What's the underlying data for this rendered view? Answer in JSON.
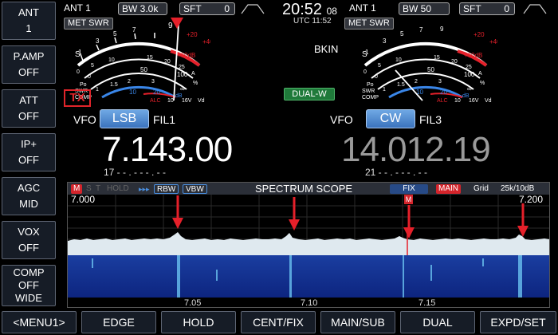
{
  "left_buttons": [
    {
      "l1": "ANT",
      "l2": "1",
      "l3": ""
    },
    {
      "l1": "P.AMP",
      "l2": "OFF",
      "l3": ""
    },
    {
      "l1": "ATT",
      "l2": "OFF",
      "l3": ""
    },
    {
      "l1": "IP+",
      "l2": "OFF",
      "l3": ""
    },
    {
      "l1": "AGC",
      "l2": "MID",
      "l3": ""
    },
    {
      "l1": "VOX",
      "l2": "OFF",
      "l3": ""
    },
    {
      "l1": "COMP",
      "l2": "OFF",
      "l3": "WIDE"
    }
  ],
  "bottom_buttons": [
    "<MENU1>",
    "EDGE",
    "HOLD",
    "CENT/FIX",
    "MAIN/SUB",
    "DUAL",
    "EXPD/SET"
  ],
  "main": {
    "ant": "ANT 1",
    "bw": "BW 3.0k",
    "sft_label": "SFT",
    "sft_value": "0",
    "met": "MET",
    "swr": "SWR",
    "tx": "TX",
    "vfo_label": "VFO",
    "mode": "LSB",
    "filter": "FIL1",
    "freq": "7.143.00",
    "sub_line": "17  - - . - - - . - -"
  },
  "sub": {
    "ant": "ANT 1",
    "bw": "BW 50",
    "sft_label": "SFT",
    "sft_value": "0",
    "met": "MET",
    "swr": "SWR",
    "bkin": "BKIN",
    "vfo_label": "VFO",
    "mode": "CW",
    "filter": "FIL3",
    "freq": "14.012.19",
    "sub_line": "21  - - . - - - . - -"
  },
  "clock": {
    "time": "20:52",
    "seconds": "08",
    "utc": "UTC 11:52"
  },
  "dual_w": "DUAL-W",
  "meter_labels": {
    "s_scale": [
      "1",
      "3",
      "5",
      "7",
      "9"
    ],
    "db_scale": [
      "+20",
      "+40",
      "+60dB"
    ],
    "po_scale": [
      "0",
      "50",
      "100",
      "%"
    ],
    "swr_scale": [
      "1",
      "1.5",
      "2",
      "3",
      "∞"
    ],
    "comp_scale": [
      "10",
      "20",
      "dB"
    ],
    "alc_label": "ALC",
    "vd_scale": [
      "10",
      "16V",
      "Vd"
    ],
    "left_tags": [
      "S",
      "Po",
      "SWR",
      "COMP"
    ],
    "id_scale": [
      "0",
      "5",
      "10",
      "15",
      "20",
      "25",
      "A"
    ]
  },
  "scope": {
    "m_tag": "M",
    "s_tag": "S",
    "t_tag": "T",
    "hold": "HOLD",
    "rbw": "RBW",
    "vbw": "VBW",
    "title": "SPECTRUM SCOPE",
    "fix": "FIX",
    "main": "MAIN",
    "grid": "Grid",
    "span": "25k/10dB",
    "edge_low": "7.000",
    "edge_high": "7.200",
    "marker": "M",
    "freq_ticks": [
      "7.05",
      "7.10",
      "7.15"
    ]
  },
  "colors": {
    "accent": "#4a8fe0",
    "tx_red": "#e0242a",
    "dual_green": "#1f7a3a",
    "meter_red": "#e5202a",
    "meter_blue": "#3a86e8"
  }
}
